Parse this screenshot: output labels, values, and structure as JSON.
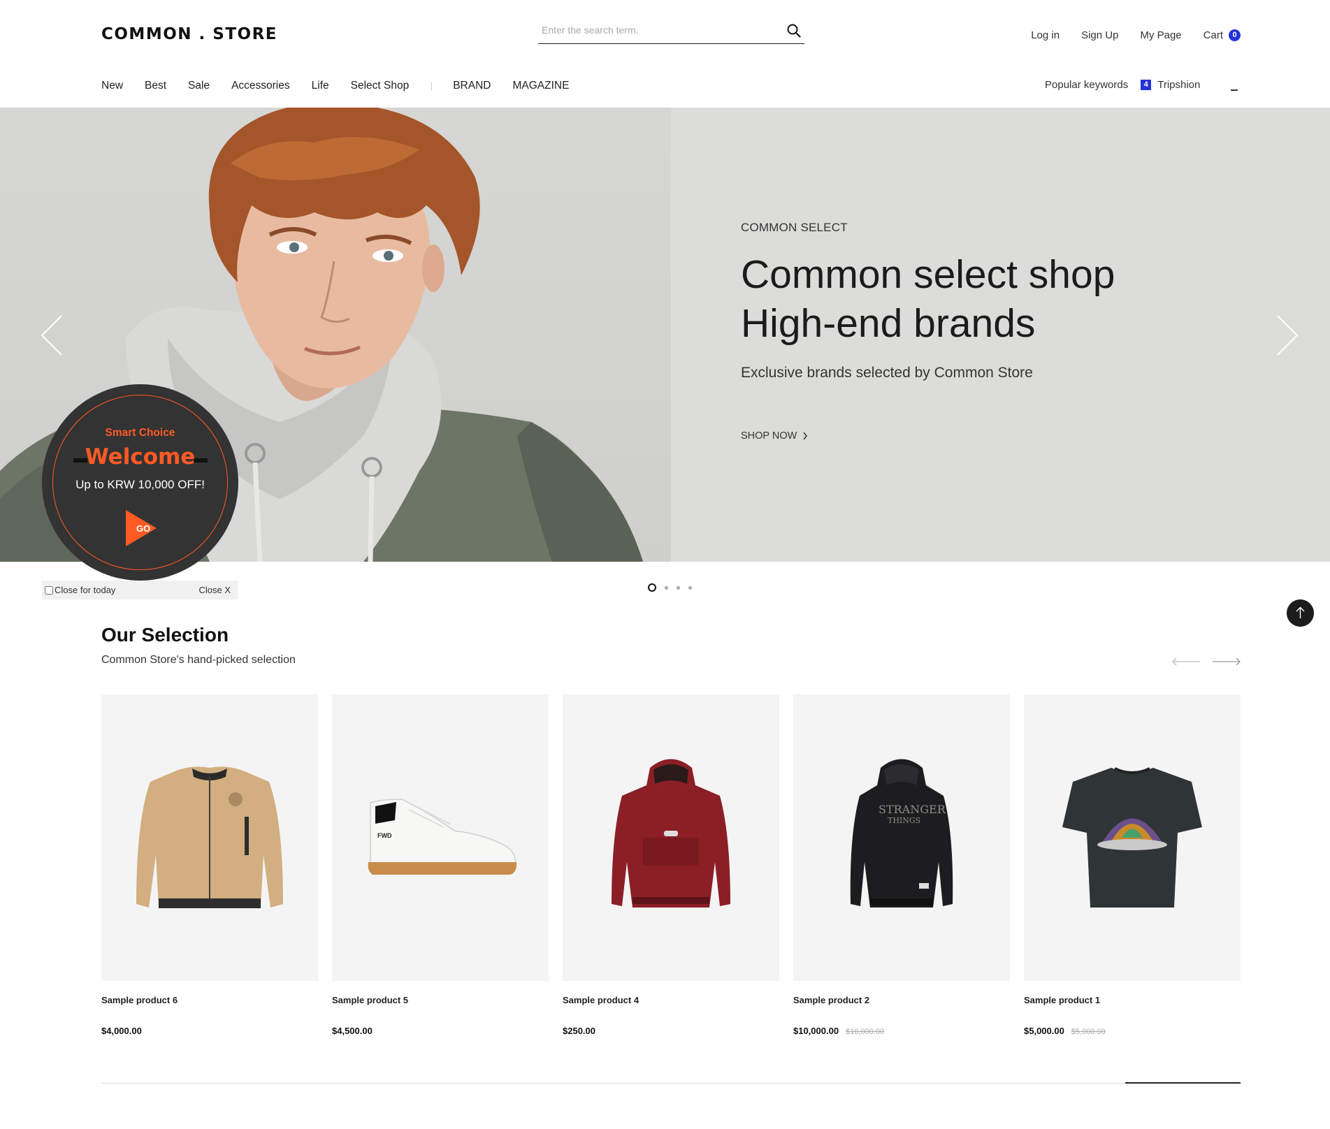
{
  "header": {
    "logo": "COMMON . STORE",
    "search_placeholder": "Enter the search term.",
    "util": {
      "login": "Log in",
      "signup": "Sign Up",
      "mypage": "My Page",
      "cart": "Cart",
      "cart_count": "0"
    }
  },
  "nav": {
    "items": [
      "New",
      "Best",
      "Sale",
      "Accessories",
      "Life",
      "Select Shop"
    ],
    "secondary": [
      "BRAND",
      "MAGAZINE"
    ],
    "popular_label": "Popular keywords",
    "popular_rank": "4",
    "popular_keyword": "Tripshion"
  },
  "hero": {
    "eyebrow": "COMMON SELECT",
    "title_line1": "Common select shop",
    "title_line2": "High-end brands",
    "subtitle": "Exclusive brands selected by Common Store",
    "cta": "SHOP NOW",
    "slide_count": 4,
    "active_slide": 1
  },
  "popup": {
    "kicker": "Smart Choice",
    "headline": "Welcome",
    "offer": "Up to KRW 10,000 OFF!",
    "go": "GO",
    "close_today": "Close for today",
    "close": "Close X",
    "accent": "#ff5a24"
  },
  "selection": {
    "title": "Our Selection",
    "subtitle": "Common Store's hand-picked selection",
    "products": [
      {
        "name": "Sample product 6",
        "price": "$4,000.00",
        "original": "",
        "image": "beige-bomber-jacket"
      },
      {
        "name": "Sample product 5",
        "price": "$4,500.00",
        "original": "",
        "image": "white-sneaker"
      },
      {
        "name": "Sample product 4",
        "price": "$250.00",
        "original": "",
        "image": "burgundy-anorak"
      },
      {
        "name": "Sample product 2",
        "price": "$10,000.00",
        "original": "$10,000.00",
        "image": "black-hoodie"
      },
      {
        "name": "Sample product 1",
        "price": "$5,000.00",
        "original": "$5,000.00",
        "image": "black-graphic-tee"
      }
    ]
  },
  "colors": {
    "accent_blue": "#2632d6",
    "hero_bg": "#dcdcda",
    "card_bg": "#f4f4f4"
  }
}
